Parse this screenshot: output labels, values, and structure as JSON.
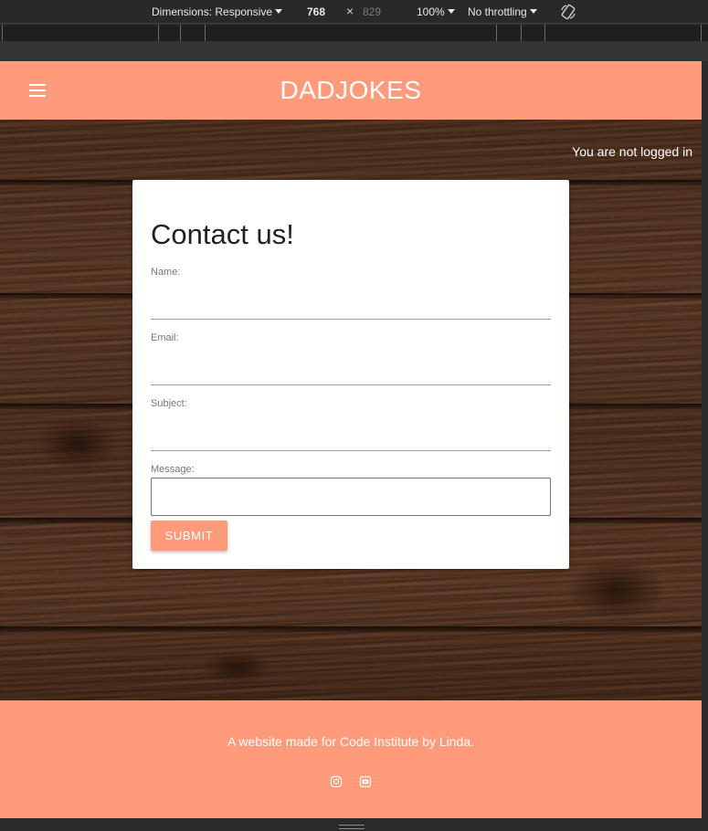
{
  "devtools": {
    "dimensions_label": "Dimensions: Responsive",
    "width": "768",
    "times": "×",
    "height": "829",
    "zoom": "100%",
    "throttling": "No throttling",
    "rotate_icon": "rotate-icon"
  },
  "navbar": {
    "brand": "DADJOKES",
    "menu_icon": "hamburger-menu-icon"
  },
  "status": {
    "login_text": "You are not logged in"
  },
  "contact_form": {
    "title": "Contact us!",
    "name_label": "Name:",
    "email_label": "Email:",
    "subject_label": "Subject:",
    "message_label": "Message:",
    "name_value": "",
    "email_value": "",
    "subject_value": "",
    "message_value": "",
    "submit_label": "SUBMIT"
  },
  "footer": {
    "text": "A website made for Code Institute by Linda.",
    "icons": [
      "instagram-icon",
      "youtube-icon"
    ]
  },
  "colors": {
    "brand": "#ff9a7b",
    "text_on_brand": "#ffffff",
    "card": "#ffffff"
  }
}
